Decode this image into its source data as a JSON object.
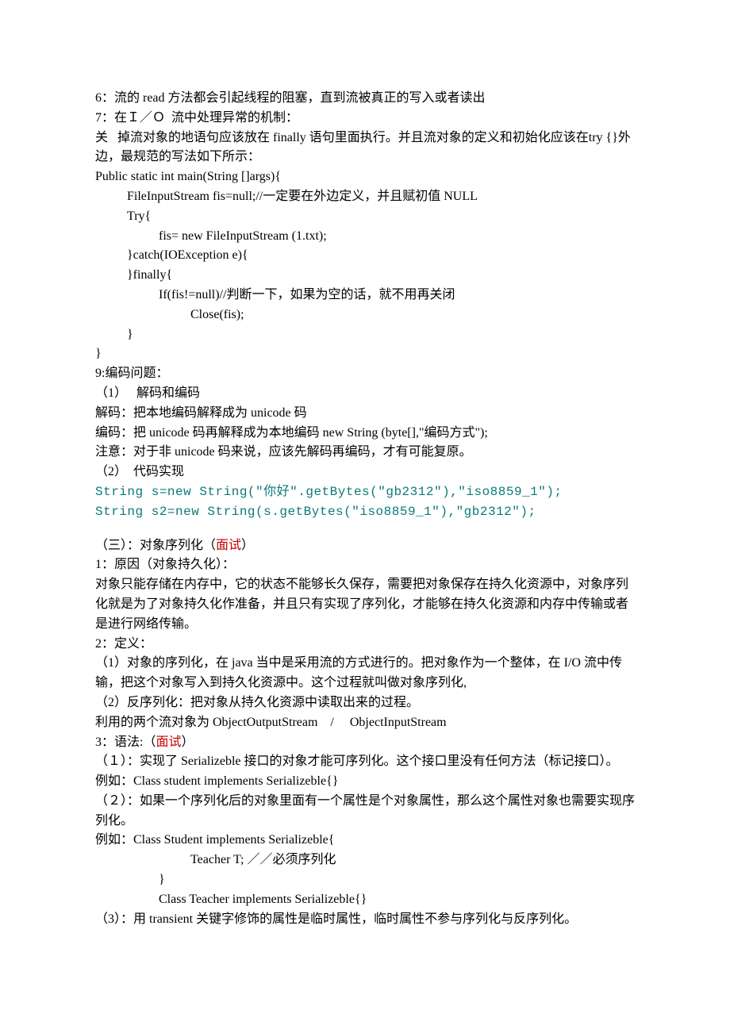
{
  "lines": {
    "l01": "6：流的 read 方法都会引起线程的阻塞，直到流被真正的写入或者读出",
    "l02": "7：在Ｉ／Ｏ  流中处理异常的机制：",
    "l03": "关   掉流对象的地语句应该放在 finally 语句里面执行。并且流对象的定义和初始化应该在try {}外边，最规范的写法如下所示：",
    "l04": "Public static int main(String []args){",
    "l05": "FileInputStream fis=null;//一定要在外边定义，并且赋初值 NULL",
    "l06": "Try{",
    "l07": "fis= new FileInputStream (1.txt);",
    "l08": "}catch(IOException e){",
    "l09": "}finally{",
    "l10": "If(fis!=null)//判断一下，如果为空的话，就不用再关闭",
    "l11": "Close(fis);",
    "l12": "}",
    "l13": "}",
    "l14": "9:编码问题：",
    "l15": "（1）   解码和编码",
    "l16": "解码：把本地编码解释成为 unicode 码",
    "l17": "编码：把 unicode 码再解释成为本地编码 new String (byte[],\"编码方式\");",
    "l18": "注意：对于非 unicode 码来说，应该先解码再编码，才有可能复原。",
    "l19": "（2）  代码实现",
    "l20": "String s=new String(\"你好\".getBytes(\"gb2312\"),\"iso8859_1\");",
    "l21": "String s2=new String(s.getBytes(\"iso8859_1\"),\"gb2312\");",
    "l22_a": "（三）：对象序列化（",
    "l22_b": "面试",
    "l22_c": "）",
    "l23": "1：原因（对象持久化）：",
    "l24": "对象只能存储在内存中，它的状态不能够长久保存，需要把对象保存在持久化资源中，对象序列化就是为了对象持久化作准备，并且只有实现了序列化，才能够在持久化资源和内存中传输或者是进行网络传输。",
    "l25": "2：定义：",
    "l26": "（1）对象的序列化，在 java 当中是采用流的方式进行的。把对象作为一个整体，在 I/O 流中传输，把这个对象写入到持久化资源中。这个过程就叫做对象序列化,",
    "l27": "（2）反序列化：把对象从持久化资源中读取出来的过程。",
    "l28": "利用的两个流对象为 ObjectOutputStream    /     ObjectInputStream",
    "l29_a": "3：语法:（",
    "l29_b": "面试",
    "l29_c": "）",
    "l30": "（１）：实现了 Serializeble 接口的对象才能可序列化。这个接口里没有任何方法（标记接口）。",
    "l31": "例如：Class student implements Serializeble{}",
    "l32": "（２）：如果一个序列化后的对象里面有一个属性是个对象属性，那么这个属性对象也需要实现序列化。",
    "l33": "例如：Class Student implements Serializeble{",
    "l34": "Teacher T; ／／必须序列化",
    "l35": "}",
    "l36": "Class Teacher implements Serializeble{}",
    "l37": "（3）：用 transient 关键字修饰的属性是临时属性，临时属性不参与序列化与反序列化。"
  }
}
